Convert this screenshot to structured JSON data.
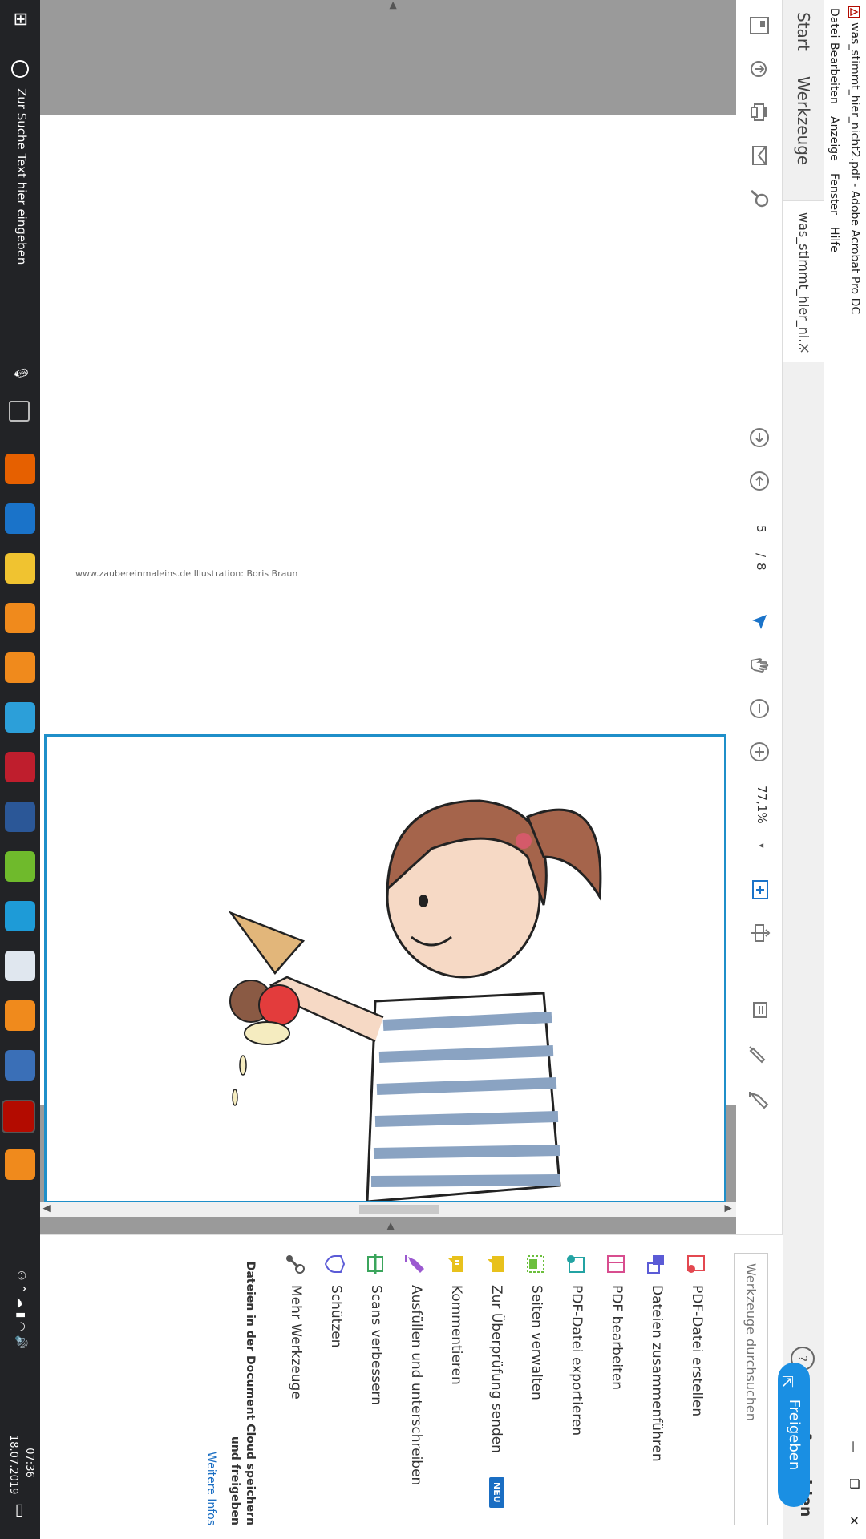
{
  "window": {
    "title": "was_stimmt_hier_nicht2.pdf - Adobe Acrobat Pro DC",
    "minimize": "—",
    "maximize": "❐",
    "close": "✕"
  },
  "menu": [
    "Datei",
    "Bearbeiten",
    "Anzeige",
    "Fenster",
    "Hilfe"
  ],
  "tabs": {
    "start": "Start",
    "werkzeuge": "Werkzeuge",
    "document": "was_stimmt_hier_ni...",
    "close": "×",
    "help": "?",
    "anmelden": "Anmelden"
  },
  "toolbar": {
    "page_current": "5",
    "page_sep": "/",
    "page_total": "8",
    "zoom": "77,1%",
    "zoom_caret": "▾"
  },
  "document": {
    "credit": "www.zaubereinmaleins.de  Illustration: Boris Braun",
    "frame_color": "#1f8fc9"
  },
  "tools": {
    "search_placeholder": "Werkzeuge durchsuchen",
    "items": [
      {
        "label": "PDF-Datei erstellen",
        "color": "#e34850",
        "icon": "create-pdf-icon"
      },
      {
        "label": "Dateien zusammenführen",
        "color": "#5b5bd6",
        "icon": "combine-files-icon"
      },
      {
        "label": "PDF bearbeiten",
        "color": "#d84d8f",
        "icon": "edit-pdf-icon"
      },
      {
        "label": "PDF-Datei exportieren",
        "color": "#23a3a3",
        "icon": "export-pdf-icon"
      },
      {
        "label": "Seiten verwalten",
        "color": "#6cbf3d",
        "icon": "organize-pages-icon"
      },
      {
        "label": "Zur Überprüfung senden",
        "color": "#e8c11c",
        "icon": "send-review-icon",
        "badge": "NEU"
      },
      {
        "label": "Kommentieren",
        "color": "#e8c11c",
        "icon": "comment-icon"
      },
      {
        "label": "Ausfüllen und unterschreiben",
        "color": "#9b59d0",
        "icon": "fill-sign-icon"
      },
      {
        "label": "Scans verbessern",
        "color": "#3ba55c",
        "icon": "enhance-scans-icon"
      },
      {
        "label": "Schützen",
        "color": "#5b5bd6",
        "icon": "protect-icon"
      },
      {
        "label": "Mehr Werkzeuge",
        "color": "#555555",
        "icon": "more-tools-icon"
      }
    ],
    "cloud_text": "Dateien in der Document Cloud speichern und freigeben",
    "more_info": "Weitere Infos",
    "share_button": "Freigeben"
  },
  "taskbar": {
    "search_text": "Zur Suche Text hier eingeben",
    "time": "07:36",
    "date": "18.07.2019",
    "apps": [
      {
        "name": "firefox",
        "color": "#e66000"
      },
      {
        "name": "edge",
        "color": "#1a73c9"
      },
      {
        "name": "file-explorer",
        "color": "#f0c330"
      },
      {
        "name": "app-orange-1",
        "color": "#f08a1c"
      },
      {
        "name": "app-orange-2",
        "color": "#f08a1c"
      },
      {
        "name": "app-blue",
        "color": "#2c9fd9"
      },
      {
        "name": "filezilla",
        "color": "#bf1e2d"
      },
      {
        "name": "word",
        "color": "#2b5797"
      },
      {
        "name": "app-green",
        "color": "#6fba2c"
      },
      {
        "name": "app-cyan",
        "color": "#1e9bd7"
      },
      {
        "name": "app-notepad",
        "color": "#e0e7ef"
      },
      {
        "name": "app-orange-3",
        "color": "#f08a1c"
      },
      {
        "name": "app-tools",
        "color": "#3a6fb7"
      },
      {
        "name": "acrobat",
        "color": "#b30b00"
      },
      {
        "name": "app-orange-4",
        "color": "#f08a1c"
      }
    ]
  }
}
